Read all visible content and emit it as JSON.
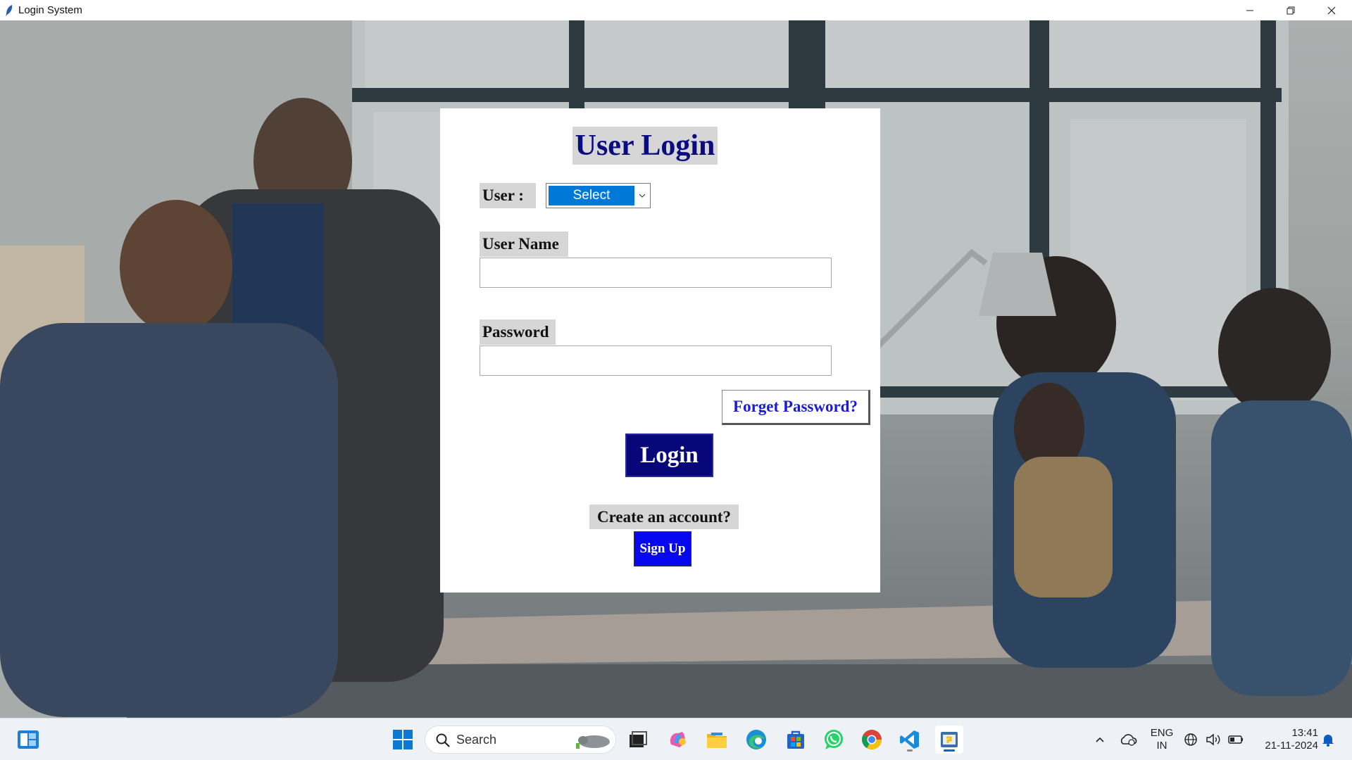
{
  "window": {
    "title": "Login System",
    "controls": [
      "minimize-icon",
      "restore-icon",
      "close-icon"
    ]
  },
  "login": {
    "heading": "User Login",
    "user_label": "User :",
    "user_select_value": "Select",
    "username_label": "User Name",
    "username_value": "",
    "password_label": "Password",
    "password_value": "",
    "forget_password": "Forget Password?",
    "login_button": "Login",
    "create_account": "Create an account?",
    "signup_button": "Sign Up"
  },
  "colors": {
    "heading_text": "#0b0b80",
    "login_button_bg": "#07077a",
    "signup_button_bg": "#0808f0",
    "select_highlight": "#0078d7",
    "forget_text": "#1a1ad8"
  },
  "taskbar": {
    "search_placeholder": "Search",
    "apps": [
      "start-icon",
      "search-icon",
      "task-view-icon",
      "copilot-icon",
      "file-explorer-icon",
      "edge-icon",
      "store-icon",
      "whatsapp-icon",
      "chrome-icon",
      "vscode-icon",
      "python-tk-icon"
    ],
    "tray": {
      "language_line1": "ENG",
      "language_line2": "IN",
      "time": "13:41",
      "date": "21-11-2024"
    }
  }
}
